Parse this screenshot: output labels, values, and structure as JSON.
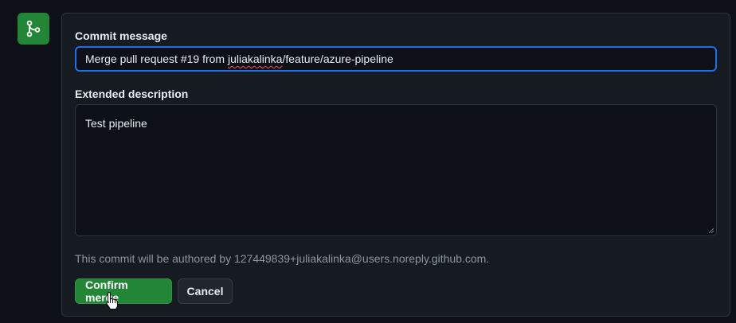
{
  "icons": {
    "merge": "git-merge-icon",
    "cursor": "hand-pointer-icon"
  },
  "colors": {
    "accent_green": "#238636",
    "focus_blue": "#1f6feb",
    "background": "#0d1117"
  },
  "form": {
    "commit_label": "Commit message",
    "commit_value_before": "Merge pull request #19 from ",
    "commit_value_flagged": "juliakalinka",
    "commit_value_after": "/feature/azure-pipeline",
    "description_label": "Extended description",
    "description_value": "Test pipeline",
    "author_note": "This commit will be authored by 127449839+juliakalinka@users.noreply.github.com."
  },
  "actions": {
    "confirm_label": "Confirm merge",
    "cancel_label": "Cancel"
  }
}
